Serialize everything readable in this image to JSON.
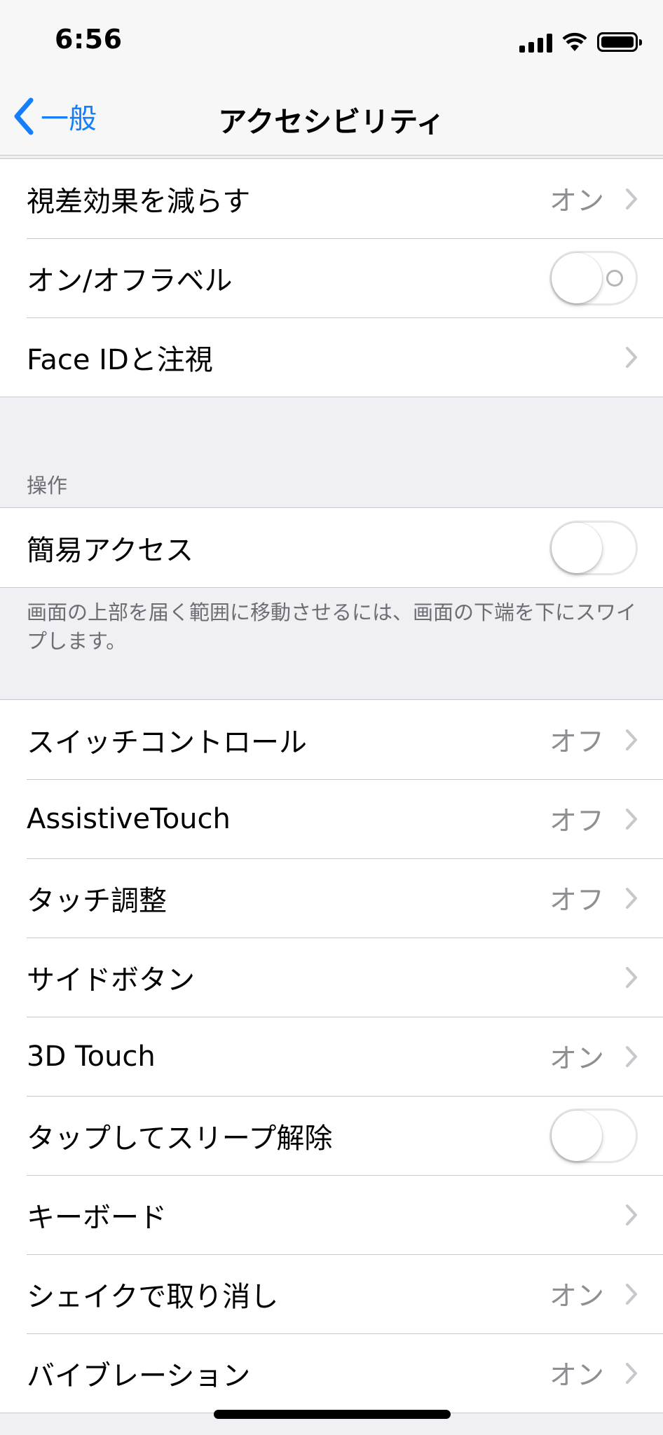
{
  "status_bar": {
    "time": "6:56"
  },
  "nav": {
    "back_label": "一般",
    "title": "アクセシビリティ"
  },
  "group1": {
    "rows": [
      {
        "label": "視差効果を減らす",
        "value": "オン"
      },
      {
        "label": "オン/オフラベル",
        "toggle": "off"
      },
      {
        "label": "Face IDと注視",
        "value": ""
      }
    ]
  },
  "section_interaction": {
    "header": "操作",
    "reachability": {
      "label": "簡易アクセス",
      "toggle": "off"
    },
    "footer": "画面の上部を届く範囲に移動させるには、画面の下端を下にスワイプします。"
  },
  "group3": {
    "rows": [
      {
        "label": "スイッチコントロール",
        "value": "オフ"
      },
      {
        "label": "AssistiveTouch",
        "value": "オフ"
      },
      {
        "label": "タッチ調整",
        "value": "オフ"
      },
      {
        "label": "サイドボタン",
        "value": ""
      },
      {
        "label": "3D Touch",
        "value": "オン"
      },
      {
        "label": "タップしてスリープ解除",
        "toggle": "off"
      },
      {
        "label": "キーボード",
        "value": ""
      },
      {
        "label": "シェイクで取り消し",
        "value": "オン"
      },
      {
        "label": "バイブレーション",
        "value": "オン"
      }
    ]
  },
  "colors": {
    "accent": "#147efb",
    "background": "#efeff4",
    "separator": "#c8c7cc",
    "secondary_text": "#8e8e93"
  }
}
